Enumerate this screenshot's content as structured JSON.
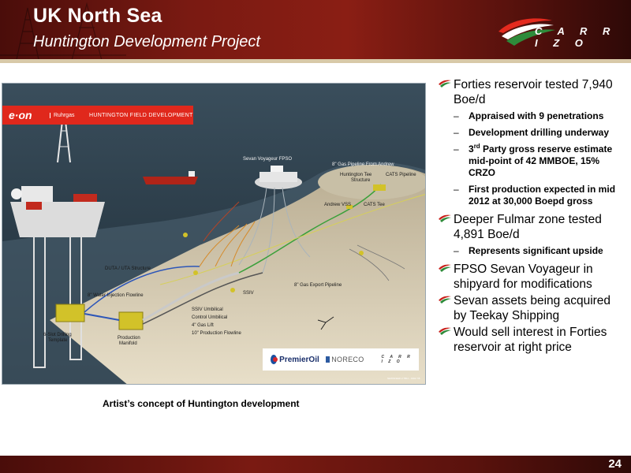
{
  "header": {
    "title": "UK North Sea",
    "subtitle": "Huntington Development Project",
    "logo_text": "C A R R I Z O"
  },
  "illustration": {
    "banner_logo": "e·on",
    "banner_sub": "Ruhrgas",
    "banner_title": "HUNTINGTON FIELD DEVELOPMENT",
    "labels": {
      "fpso": "Sevan Voyageur FPSO",
      "gas_pipeline_andrew": "8\" Gas Pipeline From Andrew",
      "huntington_tee": "Huntington Tee",
      "structure": "Structure",
      "cats_pipeline": "CATS Pipeline",
      "andrew_vss": "Andrew VSS",
      "cats_tee": "CATS Tee",
      "duta": "DUTA / UTA Structure",
      "water_injection": "8\" Water Injection Flowline",
      "gas_export": "8\" Gas Export Pipeline",
      "ssiv": "SSIV",
      "ssiv_umbilical": "SSIV Umbilical",
      "control_umbilical": "Control Umbilical",
      "gas_lift": "4\" Gas Lift",
      "production_flowline": "10\" Production Flowline",
      "drilling_template_1": "6-Slot Drilling",
      "drilling_template_2": "Template",
      "manifold_1": "Production",
      "manifold_2": "Manifold"
    },
    "partners": {
      "premier": "PremierOil",
      "noreco": "NORECO",
      "carrizo": "C A R R I Z O"
    },
    "ref": "NEWSFEED 2.7B11 - 1992 7/8"
  },
  "caption": "Artist’s concept of Huntington development",
  "bullets": {
    "b1": "Forties reservoir tested 7,940 Boe/d",
    "b1_subs": {
      "s1": "Appraised with 9 penetrations",
      "s2": "Development drilling underway",
      "s3_a": "3",
      "s3_sup": "rd",
      "s3_b": " Party gross reserve estimate mid-point of 42 MMBOE, 15% CRZO",
      "s4": "First production expected in mid 2012 at 30,000 Boepd gross"
    },
    "b2": "Deeper Fulmar zone tested 4,891 Boe/d",
    "b2_sub": "Represents significant upside",
    "b3": "FPSO Sevan Voyageur in shipyard for modifications",
    "b4": "Sevan assets being acquired by Teekay Shipping",
    "b5": "Would sell interest in Forties reservoir at right price"
  },
  "footer": {
    "page_number": "24"
  },
  "colors": {
    "header_red": "#7a1a12",
    "accent_red": "#c8201a",
    "accent_green": "#2e8b3a"
  }
}
